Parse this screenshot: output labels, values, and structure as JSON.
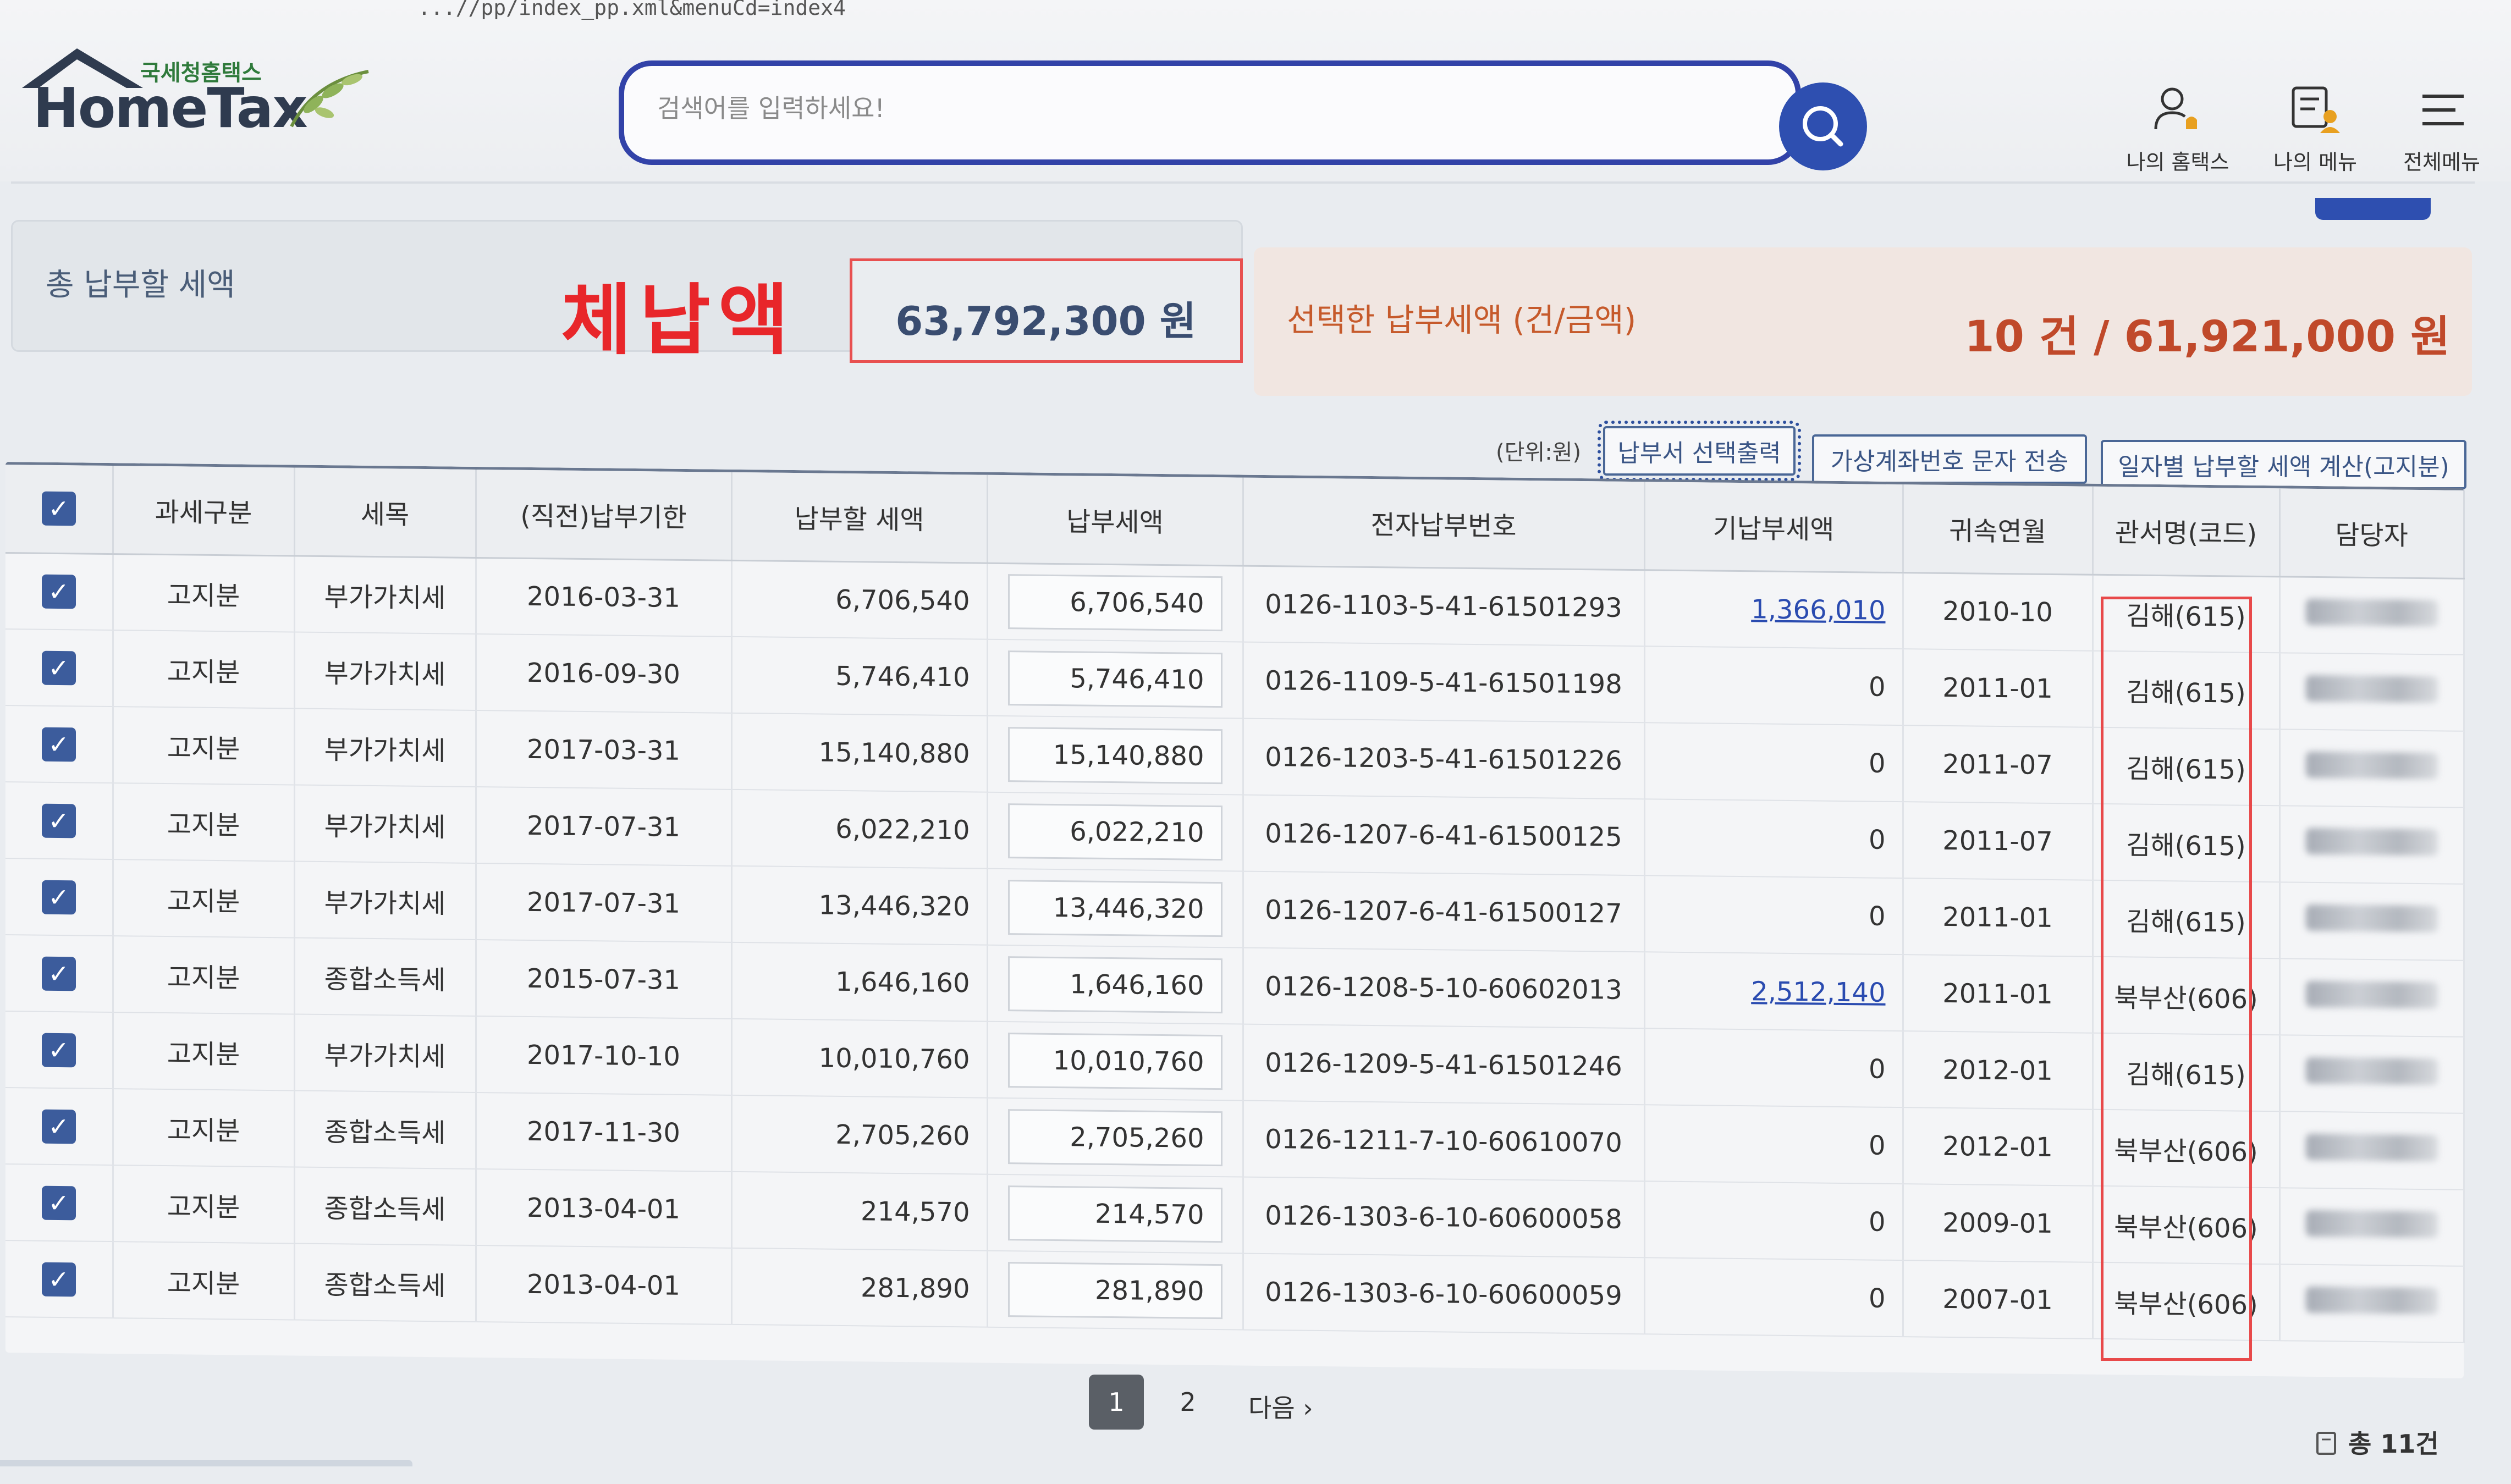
{
  "browser": {
    "url_fragment": "...//pp/index_pp.xml&menuCd=index4"
  },
  "header": {
    "logo_small_text": "국세청홈택스",
    "logo_main_text": "HomeTax",
    "search_placeholder": "검색어를 입력하세요!",
    "menus": [
      {
        "label": "나의 홈택스",
        "icon": "user-bell-icon"
      },
      {
        "label": "나의 메뉴",
        "icon": "menu-user-icon"
      },
      {
        "label": "전체메뉴",
        "icon": "hamburger-icon"
      }
    ]
  },
  "summary": {
    "total_label": "총 납부할 세액",
    "overdue_label": "체납액",
    "overdue_amount": "63,792,300 원",
    "selected_label": "선택한 납부세액 (건/금액)",
    "selected_value": "10 건 / 61,921,000 원"
  },
  "actions": {
    "unit_label": "(단위:원)",
    "print_button": "납부서 선택출력",
    "sms_button": "가상계좌번호 문자 전송",
    "calc_button": "일자별 납부할 세액 계산(고지분)"
  },
  "table": {
    "headers": [
      "과세구분",
      "세목",
      "(직전)납부기한",
      "납부할 세액",
      "납부세액",
      "전자납부번호",
      "기납부세액",
      "귀속연월",
      "관서명(코드)",
      "담당자"
    ],
    "rows": [
      {
        "type": "고지분",
        "tax": "부가가치세",
        "due": "2016-03-31",
        "amount": "6,706,540",
        "pay": "6,706,540",
        "epay_no": "0126-1103-5-41-61501293",
        "prepaid": "1,366,010",
        "prepaid_link": true,
        "period": "2010-10",
        "office": "김해(615)"
      },
      {
        "type": "고지분",
        "tax": "부가가치세",
        "due": "2016-09-30",
        "amount": "5,746,410",
        "pay": "5,746,410",
        "epay_no": "0126-1109-5-41-61501198",
        "prepaid": "0",
        "prepaid_link": false,
        "period": "2011-01",
        "office": "김해(615)"
      },
      {
        "type": "고지분",
        "tax": "부가가치세",
        "due": "2017-03-31",
        "amount": "15,140,880",
        "pay": "15,140,880",
        "epay_no": "0126-1203-5-41-61501226",
        "prepaid": "0",
        "prepaid_link": false,
        "period": "2011-07",
        "office": "김해(615)"
      },
      {
        "type": "고지분",
        "tax": "부가가치세",
        "due": "2017-07-31",
        "amount": "6,022,210",
        "pay": "6,022,210",
        "epay_no": "0126-1207-6-41-61500125",
        "prepaid": "0",
        "prepaid_link": false,
        "period": "2011-07",
        "office": "김해(615)"
      },
      {
        "type": "고지분",
        "tax": "부가가치세",
        "due": "2017-07-31",
        "amount": "13,446,320",
        "pay": "13,446,320",
        "epay_no": "0126-1207-6-41-61500127",
        "prepaid": "0",
        "prepaid_link": false,
        "period": "2011-01",
        "office": "김해(615)"
      },
      {
        "type": "고지분",
        "tax": "종합소득세",
        "due": "2015-07-31",
        "amount": "1,646,160",
        "pay": "1,646,160",
        "epay_no": "0126-1208-5-10-60602013",
        "prepaid": "2,512,140",
        "prepaid_link": true,
        "period": "2011-01",
        "office": "북부산(606)"
      },
      {
        "type": "고지분",
        "tax": "부가가치세",
        "due": "2017-10-10",
        "amount": "10,010,760",
        "pay": "10,010,760",
        "epay_no": "0126-1209-5-41-61501246",
        "prepaid": "0",
        "prepaid_link": false,
        "period": "2012-01",
        "office": "김해(615)"
      },
      {
        "type": "고지분",
        "tax": "종합소득세",
        "due": "2017-11-30",
        "amount": "2,705,260",
        "pay": "2,705,260",
        "epay_no": "0126-1211-7-10-60610070",
        "prepaid": "0",
        "prepaid_link": false,
        "period": "2012-01",
        "office": "북부산(606)"
      },
      {
        "type": "고지분",
        "tax": "종합소득세",
        "due": "2013-04-01",
        "amount": "214,570",
        "pay": "214,570",
        "epay_no": "0126-1303-6-10-60600058",
        "prepaid": "0",
        "prepaid_link": false,
        "period": "2009-01",
        "office": "북부산(606)"
      },
      {
        "type": "고지분",
        "tax": "종합소득세",
        "due": "2013-04-01",
        "amount": "281,890",
        "pay": "281,890",
        "epay_no": "0126-1303-6-10-60600059",
        "prepaid": "0",
        "prepaid_link": false,
        "period": "2007-01",
        "office": "북부산(606)"
      }
    ]
  },
  "pagination": {
    "pages": [
      "1",
      "2"
    ],
    "active": "1",
    "next_label": "다음 ›",
    "total": "총 11건"
  },
  "colors": {
    "brand_blue": "#2e4fb0",
    "overdue_red": "#e8262a",
    "selected_orange": "#c65a2b"
  }
}
